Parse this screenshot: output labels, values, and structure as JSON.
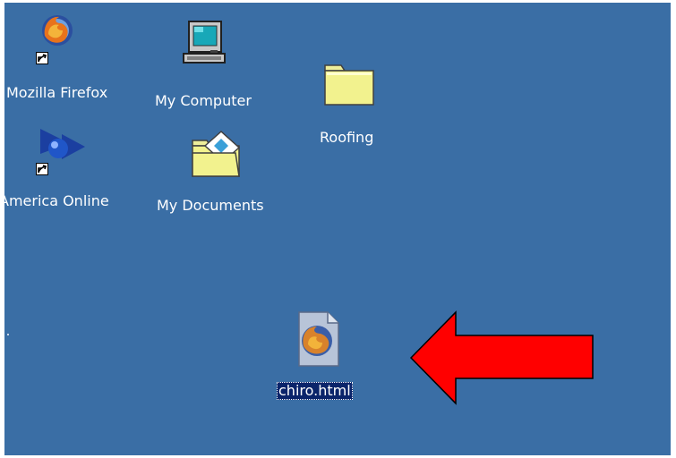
{
  "desktop": {
    "background_color": "#3a6ea5",
    "selection_color": "#0a246a",
    "arrow_color": "#ff0000",
    "icons": [
      {
        "id": "mozilla-firefox",
        "label": "Mozilla Firefox",
        "icon": "firefox-icon",
        "shortcut": true
      },
      {
        "id": "my-computer",
        "label": "My Computer",
        "icon": "computer-icon",
        "shortcut": false
      },
      {
        "id": "roofing",
        "label": "Roofing",
        "icon": "folder-icon",
        "shortcut": false
      },
      {
        "id": "america-online",
        "label": "America Online",
        "icon": "aol-icon",
        "shortcut": true
      },
      {
        "id": "my-documents",
        "label": "My Documents",
        "icon": "documents-folder-icon",
        "shortcut": false
      },
      {
        "id": "chiro-html",
        "label": "chiro.html",
        "icon": "html-file-icon",
        "shortcut": false,
        "selected": true
      }
    ]
  }
}
